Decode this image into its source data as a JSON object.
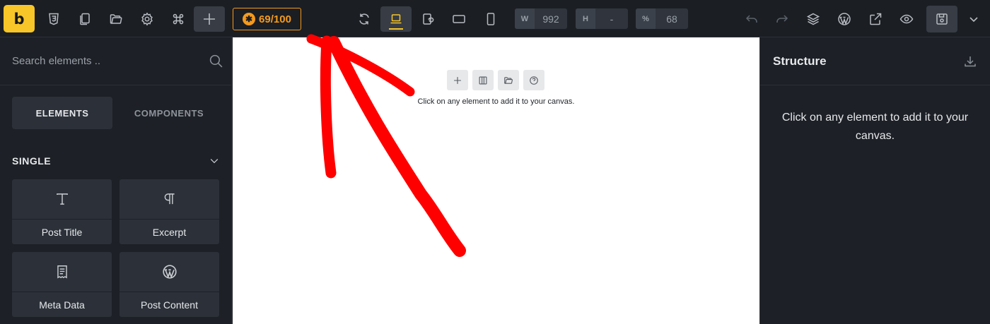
{
  "toolbar": {
    "logo_letter": "b",
    "score": "69/100",
    "width_label": "W",
    "width_value": "992",
    "height_label": "H",
    "height_value": "-",
    "zoom_label": "%",
    "zoom_value": "68"
  },
  "left_panel": {
    "search_placeholder": "Search elements ..",
    "tabs": [
      "ELEMENTS",
      "COMPONENTS"
    ],
    "section_title": "SINGLE",
    "elements": [
      {
        "label": "Post Title",
        "icon": "text-t-icon"
      },
      {
        "label": "Excerpt",
        "icon": "pilcrow-icon"
      },
      {
        "label": "Meta Data",
        "icon": "receipt-icon"
      },
      {
        "label": "Post Content",
        "icon": "wordpress-icon"
      }
    ]
  },
  "canvas": {
    "hint": "Click on any element to add it to your canvas."
  },
  "right_panel": {
    "title": "Structure",
    "empty_message": "Click on any element to add it to your canvas."
  },
  "colors": {
    "accent": "#f8c628",
    "score": "#f49a1d",
    "annotation": "#ff0000"
  }
}
